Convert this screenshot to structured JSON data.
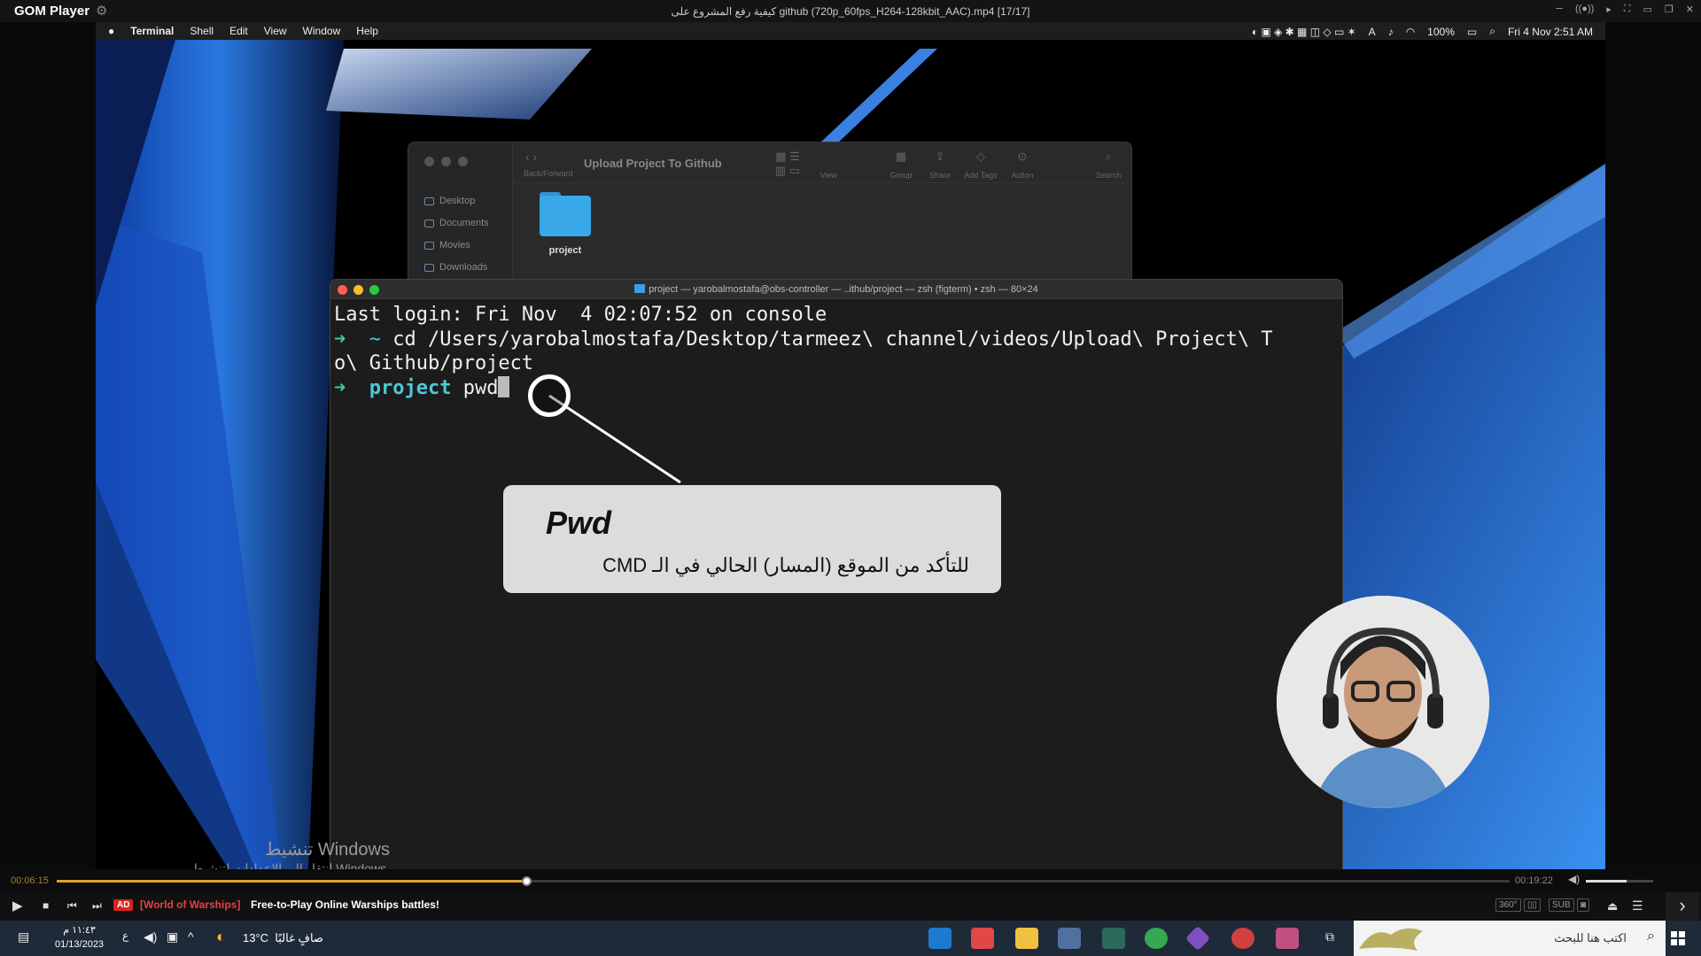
{
  "player": {
    "logo": "GOM Player",
    "file_title": "كيفية رفع المشروع على github (720p_60fps_H264-128kbit_AAC).mp4 [17/17]",
    "window_controls": [
      "─",
      "((●))",
      "▸",
      "⛶",
      "▭",
      "❐",
      "✕"
    ]
  },
  "mac": {
    "menus": [
      "Terminal",
      "Shell",
      "Edit",
      "View",
      "Window",
      "Help"
    ],
    "battery": "100%",
    "clock": "Fri 4 Nov  2:51 AM"
  },
  "finder": {
    "title": "Upload Project To Github",
    "nav_label": "Back/Forward",
    "toolbar": [
      "View",
      "Group",
      "Share",
      "Add Tags",
      "Action",
      "Search"
    ],
    "sidebar": [
      "Desktop",
      "Documents",
      "Movies",
      "Downloads"
    ],
    "folder": "project"
  },
  "terminal": {
    "title": "project — yarobalmostafa@obs-controller — ..ithub/project — zsh (figterm) • zsh — 80×24",
    "line1": "Last login: Fri Nov  4 02:07:52 on console",
    "line2_arrow": "➜",
    "line2_dir": "~",
    "line2_cmd": " cd /Users/yarobalmostafa/Desktop/tarmeez\\ channel/videos/Upload\\ Project\\ T",
    "line3": "o\\ Github/project",
    "line4_arrow": "➜",
    "line4_dir": "project",
    "line4_cmd": " pwd"
  },
  "callout": {
    "title": "Pwd",
    "desc": "للتأكد من الموقع (المسار) الحالي في الـ CMD"
  },
  "activation": {
    "title": "تنشيط Windows",
    "subtitle": "انتقل إلى الإعدادات لتنشيط Windows."
  },
  "playback": {
    "elapsed": "00:06:15",
    "total": "00:19:22",
    "progress_fraction": 0.323,
    "volume_fraction": 0.6
  },
  "ad": {
    "badge": "AD",
    "brand": "[World of Warships]",
    "text": "Free-to-Play Online Warships battles!"
  },
  "ctrl_right": [
    "360°",
    "▯▯",
    "SUB",
    "◙"
  ],
  "taskbar": {
    "time": "١١:٤٣ م",
    "date": "01/13/2023",
    "lang": "ع",
    "temp": "13°C",
    "weather": "صافٍ غالبًا",
    "search_placeholder": "اكتب هنا للبحث"
  }
}
